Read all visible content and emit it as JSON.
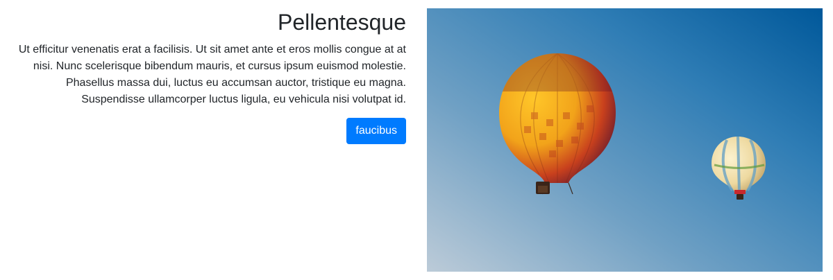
{
  "card": {
    "title": "Pellentesque",
    "body": "Ut efficitur venenatis erat a facilisis. Ut sit amet ante et eros mollis congue at at nisi. Nunc scelerisque bibendum mauris, et cursus ipsum euismod molestie. Phasellus massa dui, luctus eu accumsan auctor, tristique eu magna. Suspendisse ullamcorper luctus ligula, eu vehicula nisi volutpat id.",
    "button_label": "faucibus"
  },
  "image": {
    "icon": "hot-air-balloons-photo",
    "colors": {
      "sky_top": "#00589a",
      "sky_bottom": "#b8cad8",
      "button": "#007bff"
    }
  }
}
